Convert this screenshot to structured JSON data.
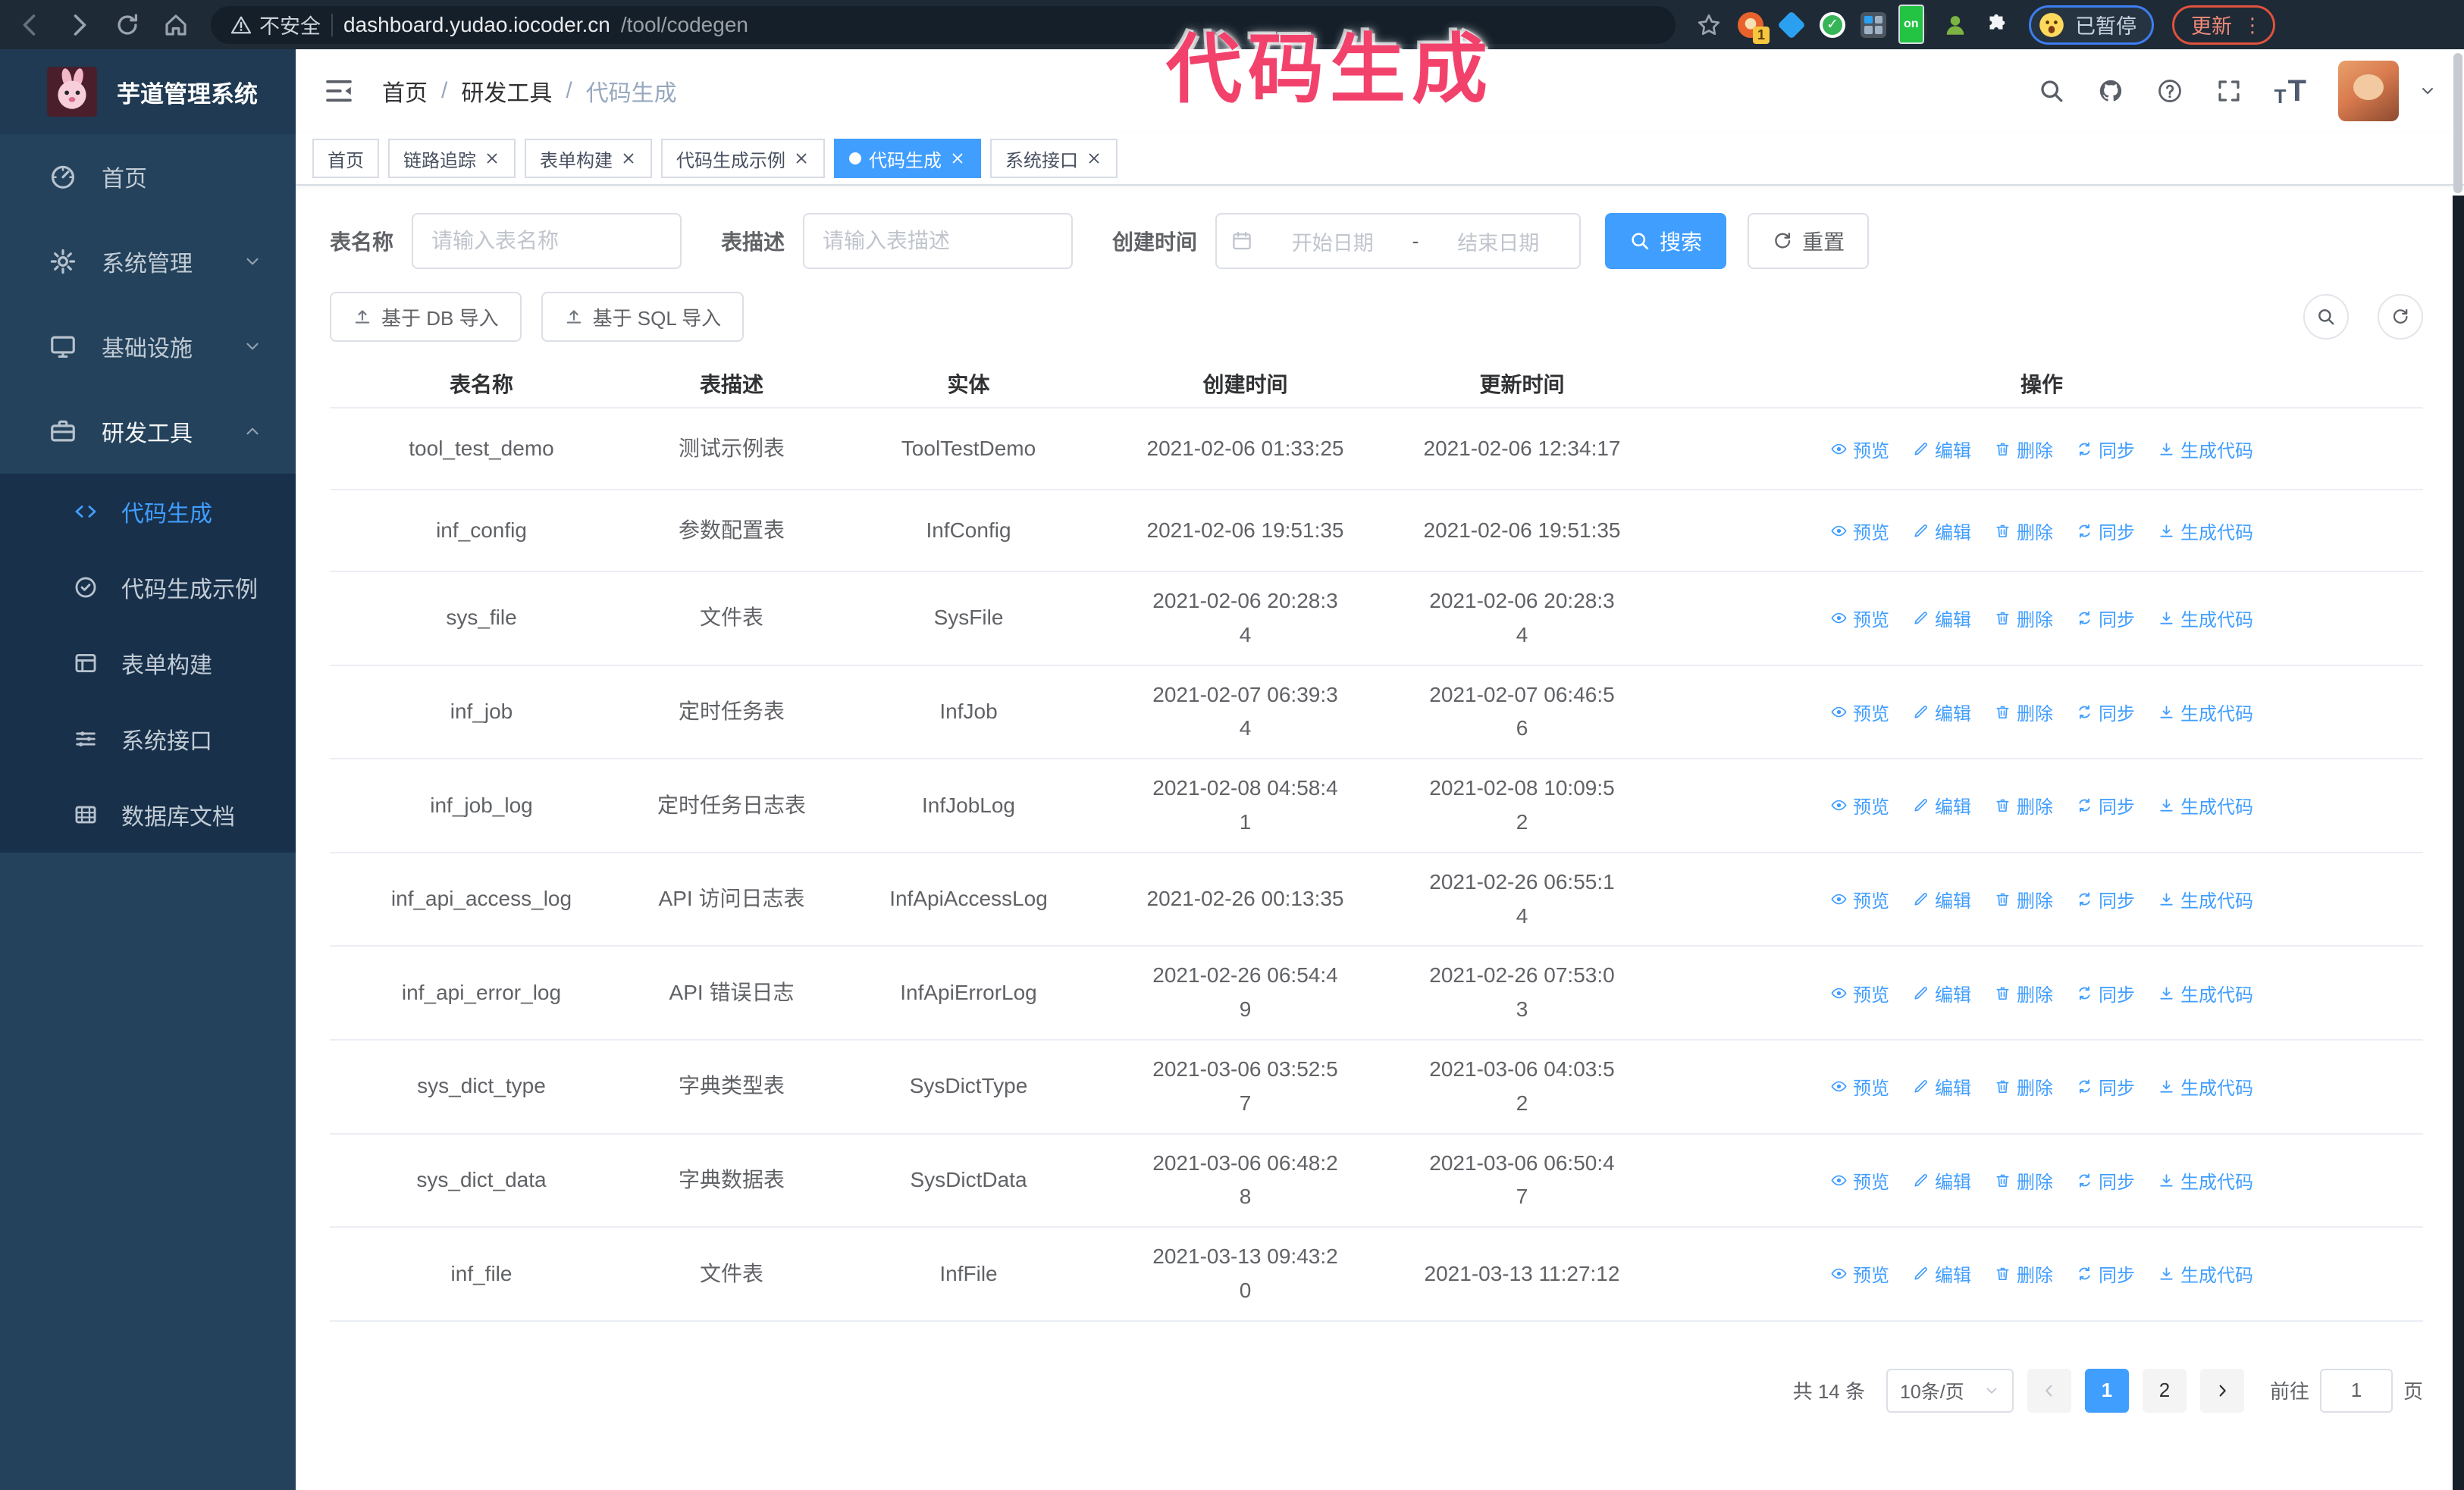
{
  "browser": {
    "security_label": "不安全",
    "url_host": "dashboard.yudao.iocoder.cn",
    "url_path": "/tool/codegen",
    "extension_badge": "1",
    "extension_on_label": "on",
    "profile_chip_label": "已暂停",
    "update_chip_label": "更新"
  },
  "annotation": {
    "text": "代码生成",
    "color": "#F2426C"
  },
  "sidebar": {
    "title": "芋道管理系统",
    "items": [
      {
        "label": "首页",
        "icon": "dashboard-icon",
        "chevron": "",
        "expanded": false
      },
      {
        "label": "系统管理",
        "icon": "gear-icon",
        "chevron": "down",
        "expanded": false
      },
      {
        "label": "基础设施",
        "icon": "monitor-icon",
        "chevron": "down",
        "expanded": false
      },
      {
        "label": "研发工具",
        "icon": "toolbox-icon",
        "chevron": "up",
        "expanded": true
      }
    ],
    "sub_items": [
      {
        "label": "代码生成",
        "icon": "code-icon",
        "active": true
      },
      {
        "label": "代码生成示例",
        "icon": "badge-check-icon",
        "active": false
      },
      {
        "label": "表单构建",
        "icon": "form-icon",
        "active": false
      },
      {
        "label": "系统接口",
        "icon": "sliders-icon",
        "active": false
      },
      {
        "label": "数据库文档",
        "icon": "database-icon",
        "active": false
      }
    ]
  },
  "header": {
    "breadcrumb": [
      "首页",
      "研发工具",
      "代码生成"
    ]
  },
  "tabs": [
    {
      "label": "首页",
      "closable": false,
      "active": false
    },
    {
      "label": "链路追踪",
      "closable": true,
      "active": false
    },
    {
      "label": "表单构建",
      "closable": true,
      "active": false
    },
    {
      "label": "代码生成示例",
      "closable": true,
      "active": false
    },
    {
      "label": "代码生成",
      "closable": true,
      "active": true
    },
    {
      "label": "系统接口",
      "closable": true,
      "active": false
    }
  ],
  "search": {
    "name_label": "表名称",
    "name_placeholder": "请输入表名称",
    "desc_label": "表描述",
    "desc_placeholder": "请输入表描述",
    "date_label": "创建时间",
    "date_start_placeholder": "开始日期",
    "date_separator": "-",
    "date_end_placeholder": "结束日期",
    "search_button": "搜索",
    "reset_button": "重置"
  },
  "toolbar": {
    "import_db_label": "基于 DB 导入",
    "import_sql_label": "基于 SQL 导入"
  },
  "table": {
    "columns": [
      "表名称",
      "表描述",
      "实体",
      "创建时间",
      "更新时间",
      "操作"
    ],
    "actions": [
      "预览",
      "编辑",
      "删除",
      "同步",
      "生成代码"
    ],
    "rows": [
      {
        "name": "tool_test_demo",
        "desc": "测试示例表",
        "entity": "ToolTestDemo",
        "created": "2021-02-06 01:33:25",
        "updated": "2021-02-06 12:34:17"
      },
      {
        "name": "inf_config",
        "desc": "参数配置表",
        "entity": "InfConfig",
        "created": "2021-02-06 19:51:35",
        "updated": "2021-02-06 19:51:35"
      },
      {
        "name": "sys_file",
        "desc": "文件表",
        "entity": "SysFile",
        "created": "2021-02-06 20:28:3\n4",
        "updated": "2021-02-06 20:28:3\n4"
      },
      {
        "name": "inf_job",
        "desc": "定时任务表",
        "entity": "InfJob",
        "created": "2021-02-07 06:39:3\n4",
        "updated": "2021-02-07 06:46:5\n6"
      },
      {
        "name": "inf_job_log",
        "desc": "定时任务日志表",
        "entity": "InfJobLog",
        "created": "2021-02-08 04:58:4\n1",
        "updated": "2021-02-08 10:09:5\n2"
      },
      {
        "name": "inf_api_access_log",
        "desc": "API 访问日志表",
        "entity": "InfApiAccessLog",
        "created": "2021-02-26 00:13:35",
        "updated": "2021-02-26 06:55:1\n4"
      },
      {
        "name": "inf_api_error_log",
        "desc": "API 错误日志",
        "entity": "InfApiErrorLog",
        "created": "2021-02-26 06:54:4\n9",
        "updated": "2021-02-26 07:53:0\n3"
      },
      {
        "name": "sys_dict_type",
        "desc": "字典类型表",
        "entity": "SysDictType",
        "created": "2021-03-06 03:52:5\n7",
        "updated": "2021-03-06 04:03:5\n2"
      },
      {
        "name": "sys_dict_data",
        "desc": "字典数据表",
        "entity": "SysDictData",
        "created": "2021-03-06 06:48:2\n8",
        "updated": "2021-03-06 06:50:4\n7"
      },
      {
        "name": "inf_file",
        "desc": "文件表",
        "entity": "InfFile",
        "created": "2021-03-13 09:43:2\n0",
        "updated": "2021-03-13 11:27:12"
      }
    ]
  },
  "pagination": {
    "total": "共 14 条",
    "page_size": "10条/页",
    "pages": [
      "1",
      "2"
    ],
    "active_page": "1",
    "goto_label": "前往",
    "goto_value": "1",
    "goto_suffix": "页"
  },
  "colors": {
    "primary": "#409EFF",
    "sidebar": "#24425B",
    "submenu": "#18304A"
  }
}
